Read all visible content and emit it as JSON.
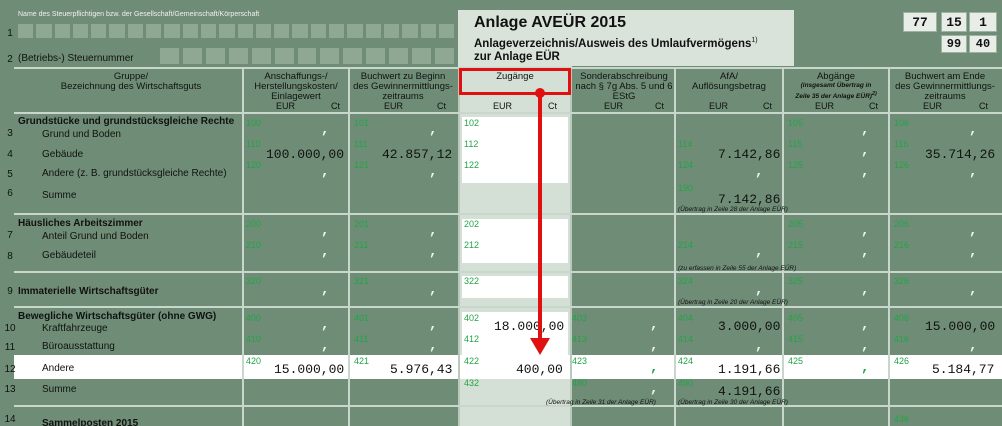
{
  "taxpayer_label": "Name des Steuerpflichtigen bzw. der Gesellschaft/Gemeinschaft/Körperschaft",
  "tax_number_label": "(Betriebs-) Steuernummer",
  "title": "Anlage AVEÜR 2015",
  "subtitle": "Anlageverzeichnis/Ausweis des Umlaufvermögens",
  "subtitle_sup": "1)",
  "subtitle2": "zur Anlage EÜR",
  "codes": {
    "c1": "77",
    "c2": "15",
    "c3": "1",
    "c4": "99",
    "c5": "40"
  },
  "headers": {
    "group": "Gruppe/\nBezeichnung des Wirtschaftsguts",
    "acq": "Anschaffungs-/\nHerstellungskosten/\nEinlagewert",
    "book_start": "Buchwert zu Beginn\ndes Gewinnermittlungs-\nzeitraums",
    "zugaenge": "Zugänge",
    "sonder": "Sonderabschreibung\nnach § 7g Abs. 5 und 6\nEStG",
    "afa": "AfA/\nAuflösungsbetrag",
    "abgaenge": "Abgänge",
    "abgaenge_note": "(insgesamt Übertrag in\nZeile 35 der Anlage EÜR)",
    "abgaenge_sup": "2)",
    "book_end": "Buchwert am Ende\ndes Gewinnermittlungs-\nzeitraums",
    "eur": "EUR",
    "ct": "Ct"
  },
  "rows": {
    "grund_title": "Grundstücke und grundstücksgleiche Rechte",
    "grund_boden": "Grund und Boden",
    "gebaeude": "Gebäude",
    "andere_grund": "Andere (z. B. grundstücksgleiche Rechte)",
    "summe": "Summe",
    "arbeitszimmer_title": "Häusliches Arbeitszimmer",
    "anteil": "Anteil Grund und Boden",
    "gebaeudeteil": "Gebäudeteil",
    "immat": "Immaterielle Wirtschaftsgüter",
    "bewegl": "Bewegliche Wirtschaftsgüter (ohne GWG)",
    "kfz": "Kraftfahrzeuge",
    "buero": "Büroausstattung",
    "andere": "Andere",
    "summe2": "Summe",
    "sammel": "Sammelposten 2015"
  },
  "row_numbers": [
    "1",
    "2",
    "3",
    "4",
    "5",
    "6",
    "7",
    "8",
    "9",
    "10",
    "11",
    "12",
    "13",
    "14"
  ],
  "field_codes": {
    "r3": [
      "100",
      "101",
      "102",
      "105",
      "106"
    ],
    "r4": [
      "110",
      "111",
      "112",
      "114",
      "115",
      "116"
    ],
    "r5": [
      "120",
      "121",
      "122",
      "124",
      "125",
      "126"
    ],
    "r6": [
      "190"
    ],
    "r7": [
      "200",
      "201",
      "202",
      "205",
      "206"
    ],
    "r8": [
      "210",
      "211",
      "212",
      "214",
      "215",
      "216"
    ],
    "r9": [
      "320",
      "321",
      "322",
      "324",
      "325",
      "326"
    ],
    "r10": [
      "400",
      "401",
      "402",
      "403",
      "404",
      "405",
      "406"
    ],
    "r11": [
      "410",
      "411",
      "412",
      "413",
      "414",
      "415",
      "416"
    ],
    "r12": [
      "420",
      "421",
      "422",
      "423",
      "424",
      "425",
      "426"
    ],
    "r13": [
      "432",
      "480",
      "490"
    ],
    "r14": [
      "436"
    ]
  },
  "values": {
    "r4_acq": "100.000,00",
    "r4_book": "42.857,12",
    "r4_afa": "7.142,86",
    "r4_end": "35.714,26",
    "r6_afa": "7.142,86",
    "r10_zug": "18.000,00",
    "r10_afa": "3.000,00",
    "r10_end": "15.000,00",
    "r12_acq": "15.000,00",
    "r12_book": "5.976,43",
    "r12_zug": "400,00",
    "r12_afa": "1.191,66",
    "r12_end": "5.184,77",
    "r13_afa": "4.191,66"
  },
  "notes": {
    "n6": "(Übertrag in Zeile 28 der Anlage EÜR)",
    "n8": "(zu erfassen in Zeile 55 der Anlage EÜR)",
    "n9": "(Übertrag in Zeile 20 der Anlage EÜR)",
    "n13a": "(Übertrag in Zeile 31 der Anlage EÜR)",
    "n13b": "(Übertrag in Zeile 30 der Anlage EÜR)"
  },
  "comma": ",",
  "colors": {
    "bg": "#6f8d76",
    "highlight": "#d4e0d5",
    "accent_red": "#e01010",
    "code_green": "#22a447"
  }
}
